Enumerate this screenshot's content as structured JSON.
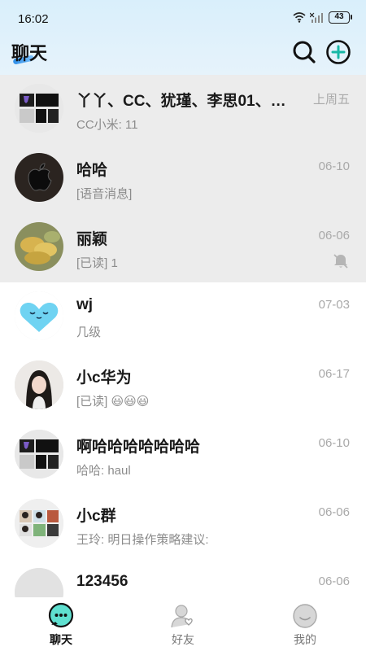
{
  "status_bar": {
    "time": "16:02",
    "battery": "43"
  },
  "header": {
    "title": "聊天",
    "search_icon": "search-icon",
    "add_icon": "plus-circle-icon",
    "accent": "#17b8a6"
  },
  "chats": [
    {
      "name": "丫丫、CC、犹瑾、李思01、…",
      "time": "上周五",
      "preview": "CC小米: 11",
      "pinned": true,
      "avatar": "group-collage"
    },
    {
      "name": "哈哈",
      "time": "06-10",
      "preview": "[语音消息]",
      "pinned": true,
      "avatar": "apple-logo"
    },
    {
      "name": "丽颖",
      "time": "06-06",
      "preview": "[已读] 1",
      "pinned": true,
      "muted": true,
      "avatar": "food-photo"
    },
    {
      "name": "wj",
      "time": "07-03",
      "preview": "几级",
      "pinned": false,
      "avatar": "blue-heart"
    },
    {
      "name": "小c华为",
      "time": "06-17",
      "preview": "[已读] 😃😃😃",
      "pinned": false,
      "avatar": "girl-photo"
    },
    {
      "name": "啊哈哈哈哈哈哈哈",
      "time": "06-10",
      "preview": "哈哈: haul",
      "pinned": false,
      "avatar": "group-collage"
    },
    {
      "name": "小c群",
      "time": "06-06",
      "preview": "王玲: 明日操作策略建议:",
      "pinned": false,
      "avatar": "group-photos"
    },
    {
      "name": "123456",
      "time": "06-06",
      "preview": "",
      "pinned": false,
      "avatar": "gray-circle"
    }
  ],
  "tabs": [
    {
      "label": "聊天",
      "icon": "chat-bubble-icon",
      "active": true
    },
    {
      "label": "好友",
      "icon": "friends-icon",
      "active": false
    },
    {
      "label": "我的",
      "icon": "profile-icon",
      "active": false
    }
  ]
}
